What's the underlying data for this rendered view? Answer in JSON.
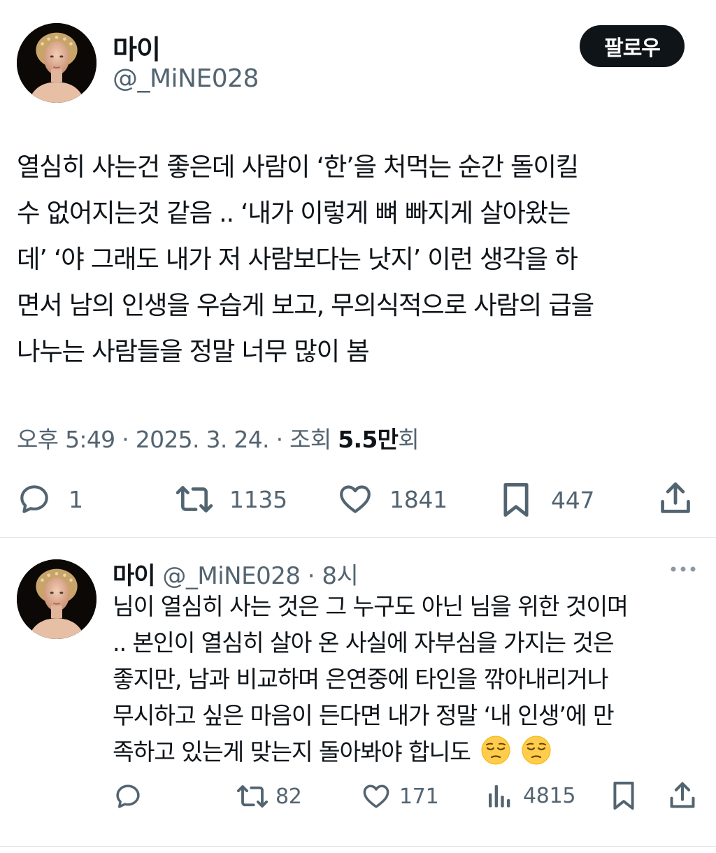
{
  "tweet": {
    "author": {
      "name": "마이",
      "handle": "@_MiNE028"
    },
    "follow_label": "팔로우",
    "text": "열심히 사는건 좋은데 사람이 ‘한’을 처먹는 순간 돌이킬\n수 없어지는것 같음 .. ‘내가 이렇게 뼈 빠지게 살아왔는\n데’ ‘야 그래도 내가 저 사람보다는 낫지’ 이런 생각을 하\n면서 남의 인생을 우습게 보고, 무의식적으로 사람의 급을\n나누는 사람들을 정말 너무 많이 봄",
    "meta": {
      "timestamp": "오후 5:49 · 2025. 3. 24. · ",
      "views_label": "조회 ",
      "views_value": "5.5만",
      "views_suffix": "회"
    },
    "actions": {
      "replies": "1",
      "retweets": "1135",
      "likes": "1841",
      "bookmarks": "447"
    },
    "icons": [
      "reply-icon",
      "retweet-icon",
      "like-icon",
      "bookmark-icon",
      "share-icon"
    ]
  },
  "reply": {
    "author": {
      "name": "마이",
      "handle": "@_MiNE028",
      "separator": " · ",
      "time": "8시"
    },
    "text": "님이 열심히 사는 것은 그 누구도 아닌 님을 위한 것이며\n.. 본인이 열심히 살아 온 사실에 자부심을 가지는 것은\n좋지만, 남과 비교하며 은연중에 타인을 깎아내리거나\n무시하고 싶은 마음이 든다면 내가 정말 ‘내 인생’에 만\n족하고 있는게 맞는지 돌아봐야 합니도",
    "emojis": [
      "pensive-face-emoji",
      "pensive-face-emoji"
    ],
    "actions": {
      "retweets": "82",
      "likes": "171",
      "views": "4815"
    },
    "icons": [
      "reply-icon",
      "retweet-icon",
      "like-icon",
      "views-icon",
      "bookmark-icon",
      "share-icon",
      "more-icon"
    ]
  },
  "colors": {
    "text": "#0f1419",
    "secondary": "#536471",
    "button_bg": "#0f1419",
    "divider": "#e1e6ea"
  }
}
